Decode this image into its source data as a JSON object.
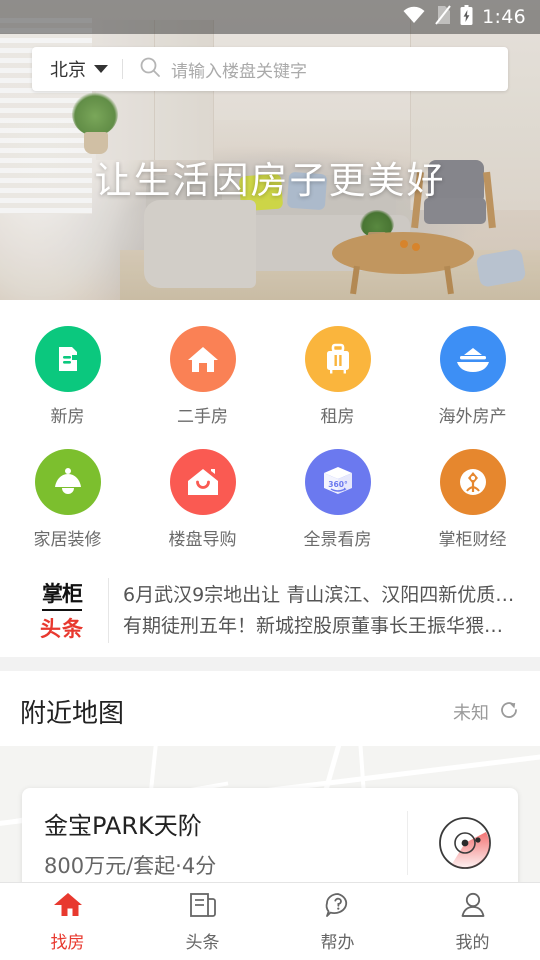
{
  "status_bar": {
    "time": "1:46",
    "icons": [
      "wifi-icon",
      "sim-card-off-icon",
      "battery-charging-icon"
    ]
  },
  "search": {
    "city": "北京",
    "city_caret": "chevron-down-icon",
    "search_icon": "search-icon",
    "placeholder": "请输入楼盘关键字"
  },
  "hero": {
    "slogan": "让生活因房子更美好"
  },
  "grid": {
    "rows": [
      [
        {
          "label": "新房",
          "icon": "document-icon",
          "color": "#0bc87e"
        },
        {
          "label": "二手房",
          "icon": "home-icon",
          "color": "#fa8155"
        },
        {
          "label": "租房",
          "icon": "suitcase-icon",
          "color": "#fab53d"
        },
        {
          "label": "海外房产",
          "icon": "ship-icon",
          "color": "#3d8ff5"
        }
      ],
      [
        {
          "label": "家居装修",
          "icon": "lamp-icon",
          "color": "#7cbf2e"
        },
        {
          "label": "楼盘导购",
          "icon": "house-smile-icon",
          "color": "#fa5a52"
        },
        {
          "label": "全景看房",
          "icon": "cube-360-icon",
          "color": "#6b79ef"
        },
        {
          "label": "掌柜财经",
          "icon": "tree-icon",
          "color": "#e6872e"
        }
      ]
    ]
  },
  "news": {
    "logo_top": "掌柜",
    "logo_bottom": "头条",
    "items": [
      "6月武汉9宗地出让 青山滨江、汉阳四新优质…",
      "有期徒刑五年！新城控股原董事长王振华猥…"
    ]
  },
  "map_section": {
    "title": "附近地图",
    "status": "未知",
    "refresh_icon": "refresh-icon",
    "card": {
      "name": "金宝PARK天阶",
      "detail": "800万元/套起·4分",
      "icon": "radar-icon"
    }
  },
  "tabbar": {
    "tabs": [
      {
        "label": "找房",
        "icon": "home-icon",
        "active": true
      },
      {
        "label": "头条",
        "icon": "news-icon",
        "active": false
      },
      {
        "label": "帮办",
        "icon": "question-icon",
        "active": false
      },
      {
        "label": "我的",
        "icon": "person-icon",
        "active": false
      }
    ],
    "active_color": "#e8392f",
    "inactive_color": "#666666"
  }
}
